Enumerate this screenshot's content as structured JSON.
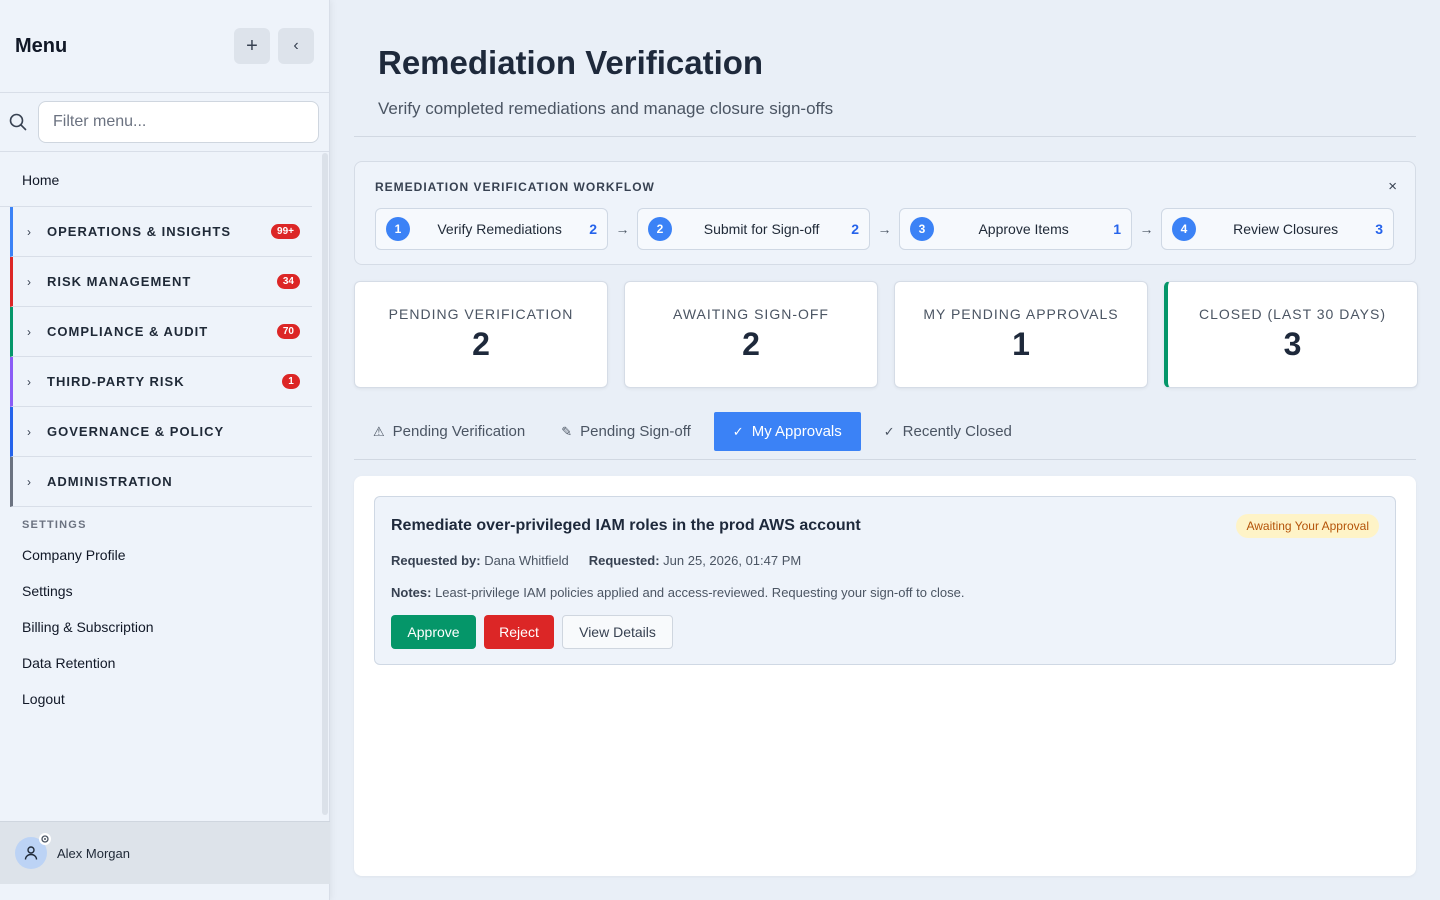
{
  "sidebar": {
    "title": "Menu",
    "add_icon": "plus-icon",
    "collapse_icon": "chevron-left-icon",
    "filter_placeholder": "Filter menu...",
    "home": "Home",
    "groups": [
      {
        "label": "OPERATIONS & INSIGHTS",
        "badge": "99+",
        "color": "#3b82f6"
      },
      {
        "label": "RISK MANAGEMENT",
        "badge": "34",
        "color": "#dc2626"
      },
      {
        "label": "COMPLIANCE & AUDIT",
        "badge": "70",
        "color": "#059669"
      },
      {
        "label": "THIRD-PARTY RISK",
        "badge": "1",
        "color": "#8b5cf6"
      },
      {
        "label": "GOVERNANCE & POLICY",
        "badge": "",
        "color": "#2563eb"
      },
      {
        "label": "ADMINISTRATION",
        "badge": "",
        "color": "#6b7280"
      }
    ],
    "settings_heading": "SETTINGS",
    "settings_links": [
      "Company Profile",
      "Settings",
      "Billing & Subscription",
      "Data Retention",
      "Logout"
    ],
    "user": {
      "name": "Alex Morgan"
    }
  },
  "page": {
    "title": "Remediation Verification",
    "subtitle": "Verify completed remediations and manage closure sign-offs"
  },
  "workflow": {
    "title": "REMEDIATION VERIFICATION WORKFLOW",
    "steps": [
      {
        "num": "1",
        "label": "Verify Remediations",
        "count": "2"
      },
      {
        "num": "2",
        "label": "Submit for Sign-off",
        "count": "2"
      },
      {
        "num": "3",
        "label": "Approve Items",
        "count": "1"
      },
      {
        "num": "4",
        "label": "Review Closures",
        "count": "3"
      }
    ],
    "arrow": "→",
    "close": "×"
  },
  "stats": [
    {
      "label": "PENDING VERIFICATION",
      "value": "2"
    },
    {
      "label": "AWAITING SIGN-OFF",
      "value": "2"
    },
    {
      "label": "MY PENDING APPROVALS",
      "value": "1"
    },
    {
      "label": "CLOSED (LAST 30 DAYS)",
      "value": "3"
    }
  ],
  "tabs": [
    {
      "icon": "⚠",
      "label": "Pending Verification",
      "active": false
    },
    {
      "icon": "✎",
      "label": "Pending Sign-off",
      "active": false
    },
    {
      "icon": "✓",
      "label": "My Approvals",
      "active": true
    },
    {
      "icon": "✓",
      "label": "Recently Closed",
      "active": false
    }
  ],
  "card": {
    "title": "Remediate over-privileged IAM roles in the prod AWS account",
    "status": "Awaiting Your Approval",
    "requested_by_label": "Requested by:",
    "requested_by": "Dana Whitfield",
    "requested_label": "Requested:",
    "requested": "Jun 25, 2026, 01:47 PM",
    "notes_label": "Notes:",
    "notes": "Least-privilege IAM policies applied and access-reviewed. Requesting your sign-off to close.",
    "approve": "Approve",
    "reject": "Reject",
    "details": "View Details"
  }
}
